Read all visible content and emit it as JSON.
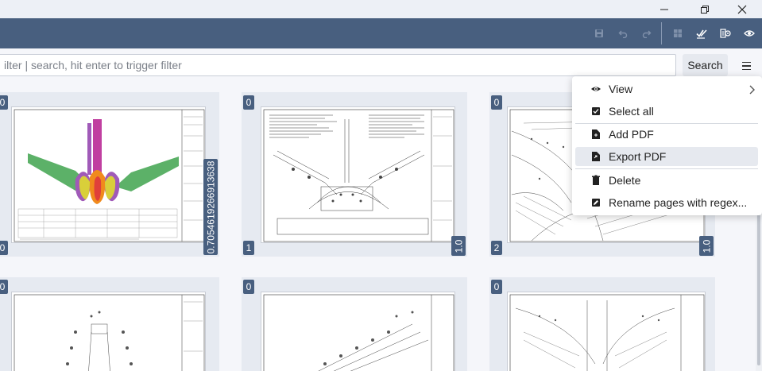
{
  "filter": {
    "placeholder": "ilter | search, hit enter to trigger filter"
  },
  "search_label": "Search",
  "pages": [
    {
      "badge_top": "0",
      "badge_bottom": "0",
      "size_label": "0.7054619266913638"
    },
    {
      "badge_top": "0",
      "badge_bottom": "1",
      "size_label": "1.0"
    },
    {
      "badge_top": "0",
      "badge_bottom": "2",
      "size_label": "1.0"
    },
    {
      "badge_top": "0"
    },
    {
      "badge_top": "0"
    },
    {
      "badge_top": "0"
    }
  ],
  "menu": {
    "items": [
      {
        "label": "View",
        "icon": "eye-icon"
      },
      {
        "label": "Select all",
        "icon": "checkbox-icon"
      },
      {
        "label": "Add PDF",
        "icon": "file-icon"
      },
      {
        "label": "Export PDF",
        "icon": "file-export-icon"
      },
      {
        "label": "Delete",
        "icon": "trash-icon"
      },
      {
        "label": "Rename pages with regex...",
        "icon": "edit-icon"
      }
    ],
    "highlighted": "Export PDF"
  },
  "colors": {
    "toolbar": "#485f7f",
    "badge": "#485f7f",
    "card": "#e6eaf1"
  }
}
